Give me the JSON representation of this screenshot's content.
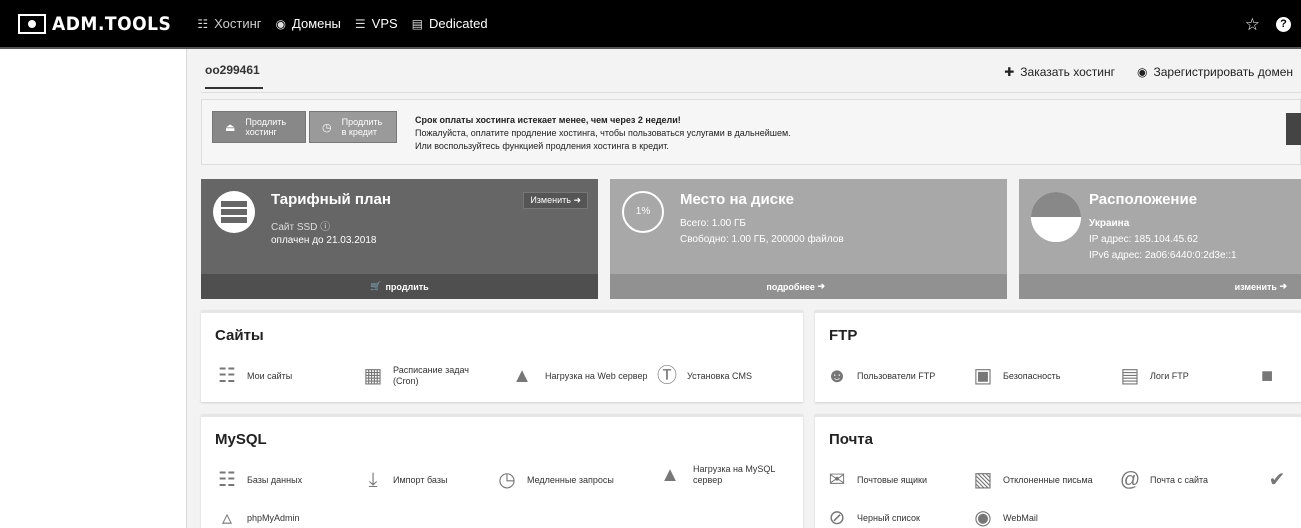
{
  "topbar": {
    "brand": "ADM.TOOLS",
    "nav": [
      {
        "label": "Хостинг",
        "icon": "sitemap-icon"
      },
      {
        "label": "Домены",
        "icon": "globe-icon"
      },
      {
        "label": "VPS",
        "icon": "server-icon"
      },
      {
        "label": "Dedicated",
        "icon": "hdd-icon"
      }
    ],
    "star_icon": "star-icon",
    "help_icon": "question-icon",
    "help_text": "?"
  },
  "tabs": {
    "account": "oo299461"
  },
  "actions": {
    "order_hosting": "Заказать хостинг",
    "register_domain": "Зарегистрировать домен"
  },
  "alert": {
    "btn_extend": [
      "Продлить",
      "хостинг"
    ],
    "btn_credit": [
      "Продлить",
      "в кредит"
    ],
    "line1": "Срок оплаты хостинга истекает менее, чем через 2 недели!",
    "line2": "Пожалуйста, оплатите продление хостинга, чтобы пользоваться услугами в дальнейшем.",
    "line3": "Или воспользуйтесь функцией продления хостинга в кредит."
  },
  "cards": {
    "plan": {
      "title": "Тарифный план",
      "name": "Сайт SSD",
      "paid": "оплачен до 21.03.2018",
      "change": "Изменить",
      "footer": "продлить",
      "color": "#666666"
    },
    "disk": {
      "title": "Место на диске",
      "percent": "1%",
      "total": "Всего: 1.00 ГБ",
      "free": "Свободно: 1.00 ГБ, 200000 файлов",
      "footer": "подробнее",
      "color": "#a8a8a8"
    },
    "location": {
      "title": "Расположение",
      "country": "Украина",
      "ip": "IP адрес: 185.104.45.62",
      "ipv6": "IPv6 адрес: 2a06:6440:0:2d3e::1",
      "footer": "изменить",
      "color": "#a8a8a8"
    }
  },
  "panels": {
    "sites": {
      "title": "Сайты",
      "items": [
        "Мои сайты",
        "Расписание задач (Cron)",
        "Нагрузка на Web сервер",
        "Установка CMS"
      ]
    },
    "ftp": {
      "title": "FTP",
      "items": [
        "Пользователи FTP",
        "Безопасность",
        "Логи FTP"
      ]
    },
    "mysql": {
      "title": "MySQL",
      "items": [
        "Базы данных",
        "Импорт базы",
        "Медленные запросы",
        "Нагрузка на MySQL сервер",
        "phpMyAdmin"
      ]
    },
    "mail": {
      "title": "Почта",
      "items": [
        "Почтовые ящики",
        "Отклоненные письма",
        "Почта с сайта",
        "Черный список",
        "WebMail"
      ]
    }
  }
}
